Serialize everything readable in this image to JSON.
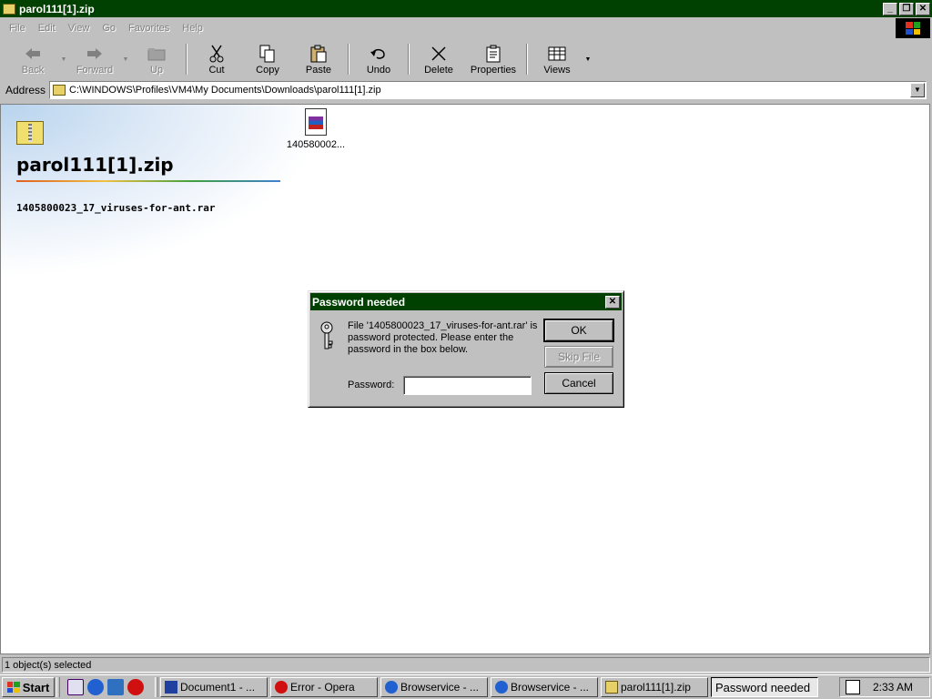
{
  "window": {
    "title": "parol111[1].zip",
    "caption_buttons": [
      "minimize",
      "restore",
      "close"
    ]
  },
  "menu": [
    "File",
    "Edit",
    "View",
    "Go",
    "Favorites",
    "Help"
  ],
  "toolbar": {
    "back": "Back",
    "forward": "Forward",
    "up": "Up",
    "cut": "Cut",
    "copy": "Copy",
    "paste": "Paste",
    "undo": "Undo",
    "delete": "Delete",
    "properties": "Properties",
    "views": "Views"
  },
  "address": {
    "label": "Address",
    "value": "C:\\WINDOWS\\Profiles\\VM4\\My Documents\\Downloads\\parol111[1].zip"
  },
  "content": {
    "folder_title": "parol111[1].zip",
    "selected_file": "1405800023_17_viruses-for-ant.rar",
    "file_item_label": "140580002..."
  },
  "dialog": {
    "title": "Password needed",
    "message": "File '1405800023_17_viruses-for-ant.rar' is password protected.  Please enter the password in the box below.",
    "password_label": "Password:",
    "password_value": "",
    "ok": "OK",
    "skip": "Skip File",
    "cancel": "Cancel"
  },
  "status": {
    "text": "1 object(s) selected"
  },
  "taskbar": {
    "start": "Start",
    "tasks": [
      {
        "label": "Document1 - ...",
        "icon": "word-icon"
      },
      {
        "label": "Error - Opera",
        "icon": "opera-icon"
      },
      {
        "label": "Browservice - ...",
        "icon": "ie-icon"
      },
      {
        "label": "Browservice - ...",
        "icon": "ie-icon"
      },
      {
        "label": "parol111[1].zip",
        "icon": "zip-folder-icon"
      },
      {
        "label": "Password needed",
        "icon": "",
        "active": true
      }
    ],
    "clock": "2:33 AM"
  },
  "colors": {
    "titlebar": "#004000",
    "face": "#c0c0c0"
  }
}
